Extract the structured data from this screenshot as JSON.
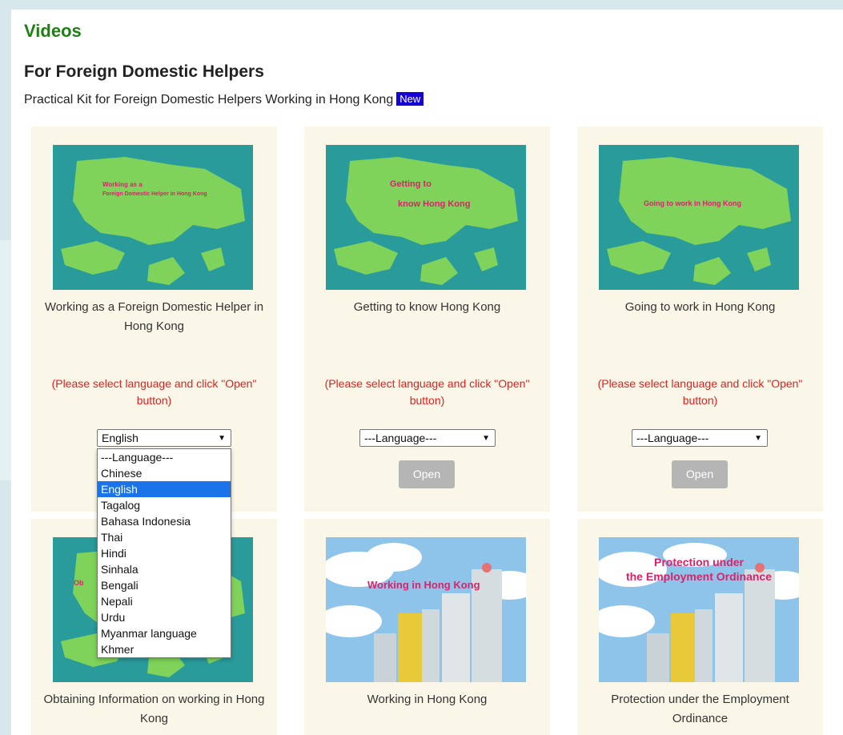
{
  "header": {
    "section_title": "Videos",
    "sub_title": "For Foreign Domestic Helpers",
    "intro_text": "Practical Kit for Foreign Domestic Helpers Working in Hong Kong",
    "new_badge": "New"
  },
  "hint_text": "(Please select language and click \"Open\" button)",
  "open_label": "Open",
  "cards": [
    {
      "caption": "Working as a Foreign Domestic Helper in Hong Kong",
      "selected_language": "English",
      "thumb_line1": "Working as a",
      "thumb_line2": "Foreign Domestic Helper in Hong Kong"
    },
    {
      "caption": "Getting to know Hong Kong",
      "selected_language": "---Language---",
      "thumb_line1": "Getting to",
      "thumb_line2": "know Hong Kong"
    },
    {
      "caption": "Going to work in Hong Kong",
      "selected_language": "---Language---",
      "thumb_line1": "Going to work in Hong Kong",
      "thumb_line2": ""
    },
    {
      "caption": "Obtaining Information on working in Hong Kong",
      "thumb_line1": "Ob",
      "thumb_line2": ""
    },
    {
      "caption": "Working in Hong Kong",
      "thumb_line1": "Working in Hong Kong",
      "thumb_line2": ""
    },
    {
      "caption": "Protection under the Employment Ordinance",
      "thumb_line1": "Protection under",
      "thumb_line2": "the Employment Ordinance"
    }
  ],
  "language_options": [
    "---Language---",
    "Chinese",
    "English",
    "Tagalog",
    "Bahasa Indonesia",
    "Thai",
    "Hindi",
    "Sinhala",
    "Bengali",
    "Nepali",
    "Urdu",
    "Myanmar language",
    "Khmer"
  ],
  "dropdown_selected": "English",
  "colors": {
    "title_green": "#1e8012",
    "hint_red": "#e02020",
    "badge_blue": "#1400d6",
    "card_bg": "#fbf7e8",
    "map_sea": "#2a9b9b",
    "map_land": "#7fd35a",
    "thumb_text": "#d6246a",
    "option_highlight": "#1a73e8",
    "button_gray": "#b5b5b5"
  },
  "icons": {
    "select_arrow": "chevron-down-icon"
  }
}
